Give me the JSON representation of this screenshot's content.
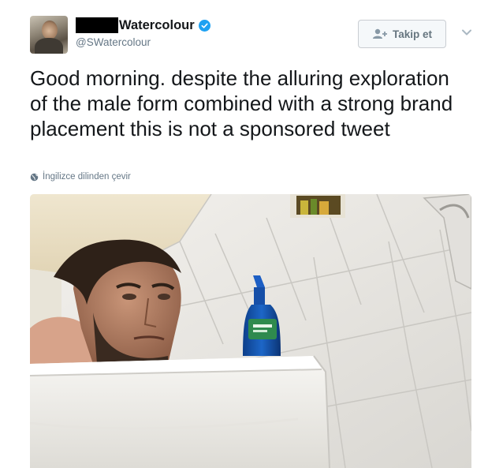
{
  "tweet": {
    "display_name": "Watercolour",
    "handle": "@SWatercolour",
    "text": "Good morning. despite the alluring exploration of the male form combined with a strong brand placement this is not a sponsored tweet",
    "translate_label": "İngilizce dilinden çevir",
    "follow_label": "Takip et"
  },
  "icons": {
    "verified": "verified-badge-icon",
    "follow": "add-user-icon",
    "more": "chevron-down-icon",
    "translate": "globe-icon"
  },
  "colors": {
    "accent": "#1da1f2",
    "text": "#14171a",
    "muted": "#657786",
    "button_text": "#66757f"
  }
}
